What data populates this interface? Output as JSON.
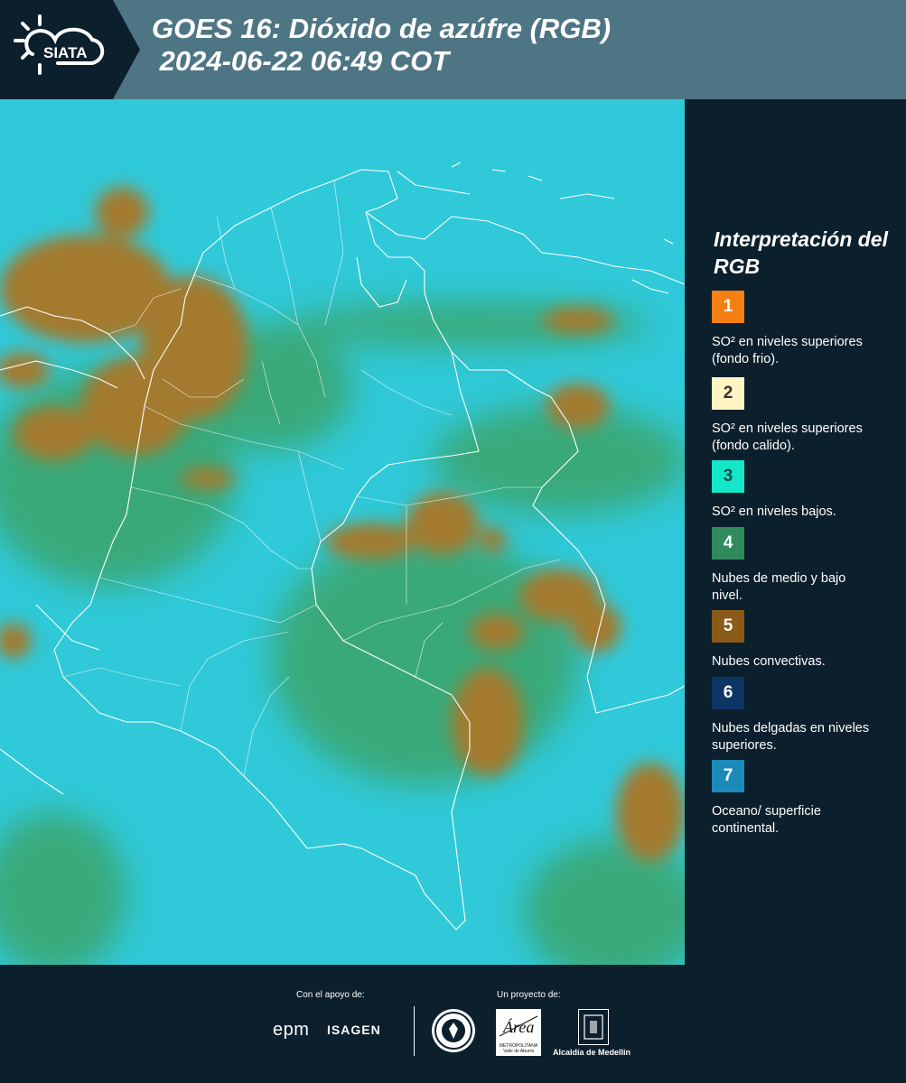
{
  "header": {
    "title_line1": "GOES 16: Dióxido de azúfre (RGB)",
    "title_line2": " 2024-06-22 06:49 COT",
    "logo_text": "SIATA"
  },
  "legend": {
    "title": "Interpretación del RGB",
    "items": [
      {
        "number": "1",
        "label": "SO² en niveles superiores (fondo frio).",
        "color": "#f47f12",
        "text_color": "#ffffff"
      },
      {
        "number": "2",
        "label": "SO² en niveles superiores (fondo calido).",
        "color": "#fff5c2",
        "text_color": "#333333"
      },
      {
        "number": "3",
        "label": "SO² en niveles bajos.",
        "color": "#12e8c8",
        "text_color": "#1a4a45"
      },
      {
        "number": "4",
        "label": "Nubes de medio y bajo nivel.",
        "color": "#2f8a5c",
        "text_color": "#ffffff"
      },
      {
        "number": "5",
        "label": "Nubes convectivas.",
        "color": "#8a5a18",
        "text_color": "#ffffff"
      },
      {
        "number": "6",
        "label": "Nubes delgadas en niveles superiores.",
        "color": "#0d3566",
        "text_color": "#ffffff"
      },
      {
        "number": "7",
        "label": "Oceano/ superficie continental.",
        "color": "#1a8bb8",
        "text_color": "#ffffff"
      }
    ]
  },
  "footer": {
    "support_label": "Con el apoyo de:",
    "project_label": "Un proyecto de:",
    "sponsor_epm": "epm",
    "sponsor_isagen": "ISAGEN",
    "partner_amva_name": "Área",
    "partner_amva_sub": "METROPOLITANA Valle de Aburrá",
    "partner_medellin": "Alcaldía de Medellín"
  },
  "map_colors": {
    "background": "#2fc9d9",
    "cloud": "#a37a2e",
    "vegetation": "#3d9f5a",
    "border": "#ffffff"
  }
}
